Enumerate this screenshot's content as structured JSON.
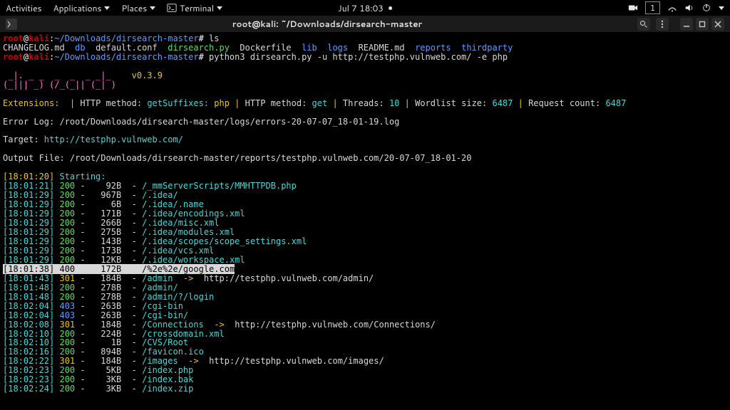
{
  "topbar": {
    "activities": "Activities",
    "applications": "Applications",
    "places": "Places",
    "terminal": "Terminal",
    "datetime": "Jul 7  18:03",
    "workspace": "1"
  },
  "window": {
    "title": "root@kali: ~/Downloads/dirsearch-master"
  },
  "prompt": {
    "user": "root",
    "host": "kali",
    "path": "~/Downloads/dirsearch-master",
    "symbol": "#"
  },
  "cmds": {
    "ls": "ls",
    "python": "python3 dirsearch.py -u http://testphp.vulnweb.com/ -e php"
  },
  "ls_out": [
    {
      "name": "CHANGELOG.md",
      "cls": "ls-white"
    },
    {
      "name": "db",
      "cls": "ls-blue"
    },
    {
      "name": "default.conf",
      "cls": "ls-white"
    },
    {
      "name": "dirsearch.py",
      "cls": "ls-green"
    },
    {
      "name": "Dockerfile",
      "cls": "ls-white"
    },
    {
      "name": "lib",
      "cls": "ls-blue"
    },
    {
      "name": "logs",
      "cls": "ls-blue"
    },
    {
      "name": "README.md",
      "cls": "ls-white"
    },
    {
      "name": "reports",
      "cls": "ls-blue"
    },
    {
      "name": "thirdparty",
      "cls": "ls-blue"
    }
  ],
  "banner": {
    "version": "v0.3.9",
    "l1": " _|. _ _  _  _  _ _|_",
    "l2": "(_||| _) (/_(_|| (_| )"
  },
  "info": {
    "ext_label": "Extensions:",
    "httpm_label": "HTTP method:",
    "getsuffix": "getSuffixes:",
    "ext_val": "php",
    "http_get": "get",
    "threads_label": "Threads:",
    "threads_val": "10",
    "wl_label": "Wordlist size:",
    "wl_val": "6487",
    "rc_label": "Request count:",
    "rc_val": "6487",
    "errlog_label": "Error Log:",
    "errlog_val": "/root/Downloads/dirsearch-master/logs/errors-20-07-07_18-01-19.log",
    "target_label": "Target:",
    "target_val": "http://testphp.vulnweb.com/",
    "outfile_label": "Output File:",
    "outfile_val": "/root/Downloads/dirsearch-master/reports/testphp.vulnweb.com/20-07-07_18-01-20",
    "start_ts": "[18:01:20]",
    "start_label": "Starting:"
  },
  "results": [
    {
      "ts": "[18:01:21]",
      "code": 200,
      "size": "92B",
      "path": "/_mmServerScripts/MMHTTPDB.php"
    },
    {
      "ts": "[18:01:29]",
      "code": 200,
      "size": "967B",
      "path": "/.idea/"
    },
    {
      "ts": "[18:01:29]",
      "code": 200,
      "size": "6B",
      "path": "/.idea/.name"
    },
    {
      "ts": "[18:01:29]",
      "code": 200,
      "size": "171B",
      "path": "/.idea/encodings.xml"
    },
    {
      "ts": "[18:01:29]",
      "code": 200,
      "size": "266B",
      "path": "/.idea/misc.xml"
    },
    {
      "ts": "[18:01:29]",
      "code": 200,
      "size": "275B",
      "path": "/.idea/modules.xml"
    },
    {
      "ts": "[18:01:29]",
      "code": 200,
      "size": "143B",
      "path": "/.idea/scopes/scope_settings.xml"
    },
    {
      "ts": "[18:01:29]",
      "code": 200,
      "size": "173B",
      "path": "/.idea/vcs.xml"
    },
    {
      "ts": "[18:01:29]",
      "code": 200,
      "size": "12KB",
      "path": "/.idea/workspace.xml"
    },
    {
      "ts": "[18:01:38]",
      "code": 400,
      "size": "172B",
      "path": "/%2e%2e/google.com"
    },
    {
      "ts": "[18:01:43]",
      "code": 301,
      "size": "184B",
      "path": "/admin",
      "redirect": "http://testphp.vulnweb.com/admin/"
    },
    {
      "ts": "[18:01:48]",
      "code": 200,
      "size": "278B",
      "path": "/admin/"
    },
    {
      "ts": "[18:01:48]",
      "code": 200,
      "size": "278B",
      "path": "/admin/?/login"
    },
    {
      "ts": "[18:02:04]",
      "code": 403,
      "size": "263B",
      "path": "/cgi-bin"
    },
    {
      "ts": "[18:02:04]",
      "code": 403,
      "size": "263B",
      "path": "/cgi-bin/"
    },
    {
      "ts": "[18:02:08]",
      "code": 301,
      "size": "184B",
      "path": "/Connections",
      "redirect": "http://testphp.vulnweb.com/Connections/"
    },
    {
      "ts": "[18:02:10]",
      "code": 200,
      "size": "224B",
      "path": "/crossdomain.xml"
    },
    {
      "ts": "[18:02:10]",
      "code": 200,
      "size": "1B",
      "path": "/CVS/Root"
    },
    {
      "ts": "[18:02:16]",
      "code": 200,
      "size": "894B",
      "path": "/favicon.ico"
    },
    {
      "ts": "[18:02:22]",
      "code": 301,
      "size": "184B",
      "path": "/images",
      "redirect": "http://testphp.vulnweb.com/images/"
    },
    {
      "ts": "[18:02:23]",
      "code": 200,
      "size": "5KB",
      "path": "/index.php"
    },
    {
      "ts": "[18:02:23]",
      "code": 200,
      "size": "3KB",
      "path": "/index.bak"
    },
    {
      "ts": "[18:02:24]",
      "code": 200,
      "size": "3KB",
      "path": "/index.zip"
    }
  ]
}
